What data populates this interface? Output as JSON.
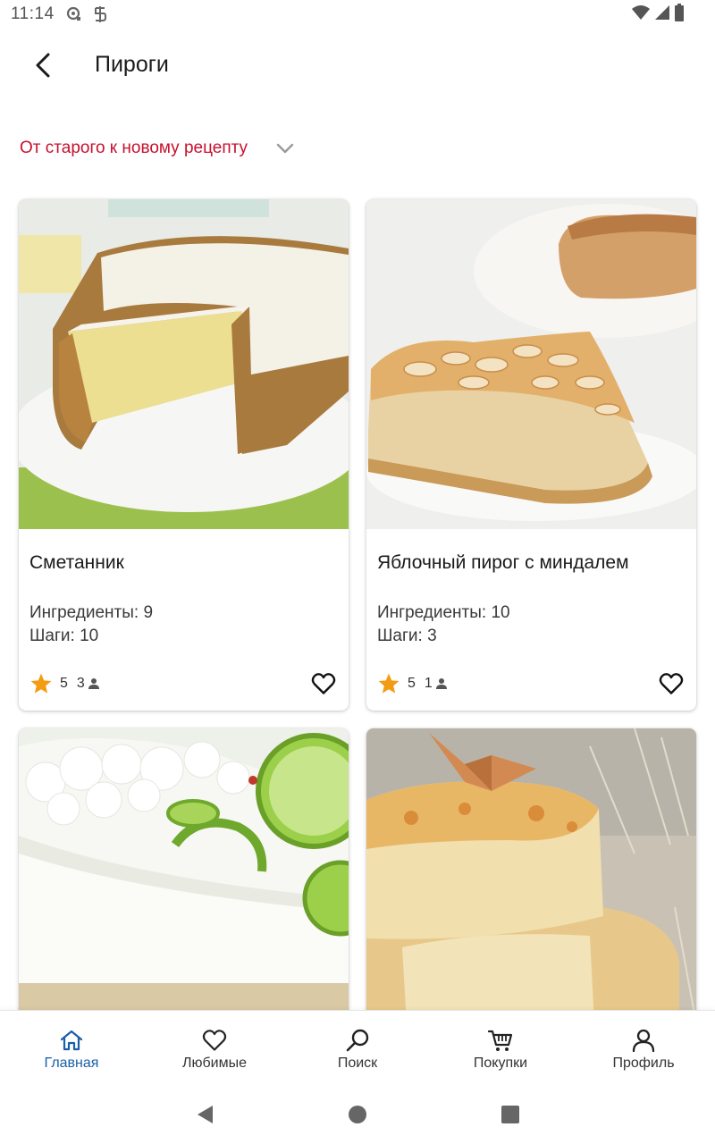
{
  "status_bar": {
    "time": "11:14"
  },
  "app_bar": {
    "back_icon": "arrow-back-icon",
    "title": "Пироги"
  },
  "sort": {
    "selected": "От старого к новому рецепту",
    "accent_color": "#c8102e"
  },
  "recipes": [
    {
      "title": "Сметанник",
      "ingredients_label": "Ингредиенты: 9",
      "steps_label": "Шаги: 10",
      "rating": "5",
      "reviews": "3"
    },
    {
      "title": "Яблочный пирог с миндалем",
      "ingredients_label": "Ингредиенты: 10",
      "steps_label": "Шаги: 3",
      "rating": "5",
      "reviews": "1"
    },
    {
      "title": "",
      "ingredients_label": "",
      "steps_label": "",
      "rating": "",
      "reviews": ""
    },
    {
      "title": "",
      "ingredients_label": "",
      "steps_label": "",
      "rating": "",
      "reviews": ""
    }
  ],
  "bottom_nav": {
    "active_color": "#1a5fa8",
    "items": [
      {
        "label": "Главная",
        "icon": "home-icon"
      },
      {
        "label": "Любимые",
        "icon": "heart-icon"
      },
      {
        "label": "Поиск",
        "icon": "search-icon"
      },
      {
        "label": "Покупки",
        "icon": "cart-icon"
      },
      {
        "label": "Профиль",
        "icon": "profile-icon"
      }
    ]
  }
}
